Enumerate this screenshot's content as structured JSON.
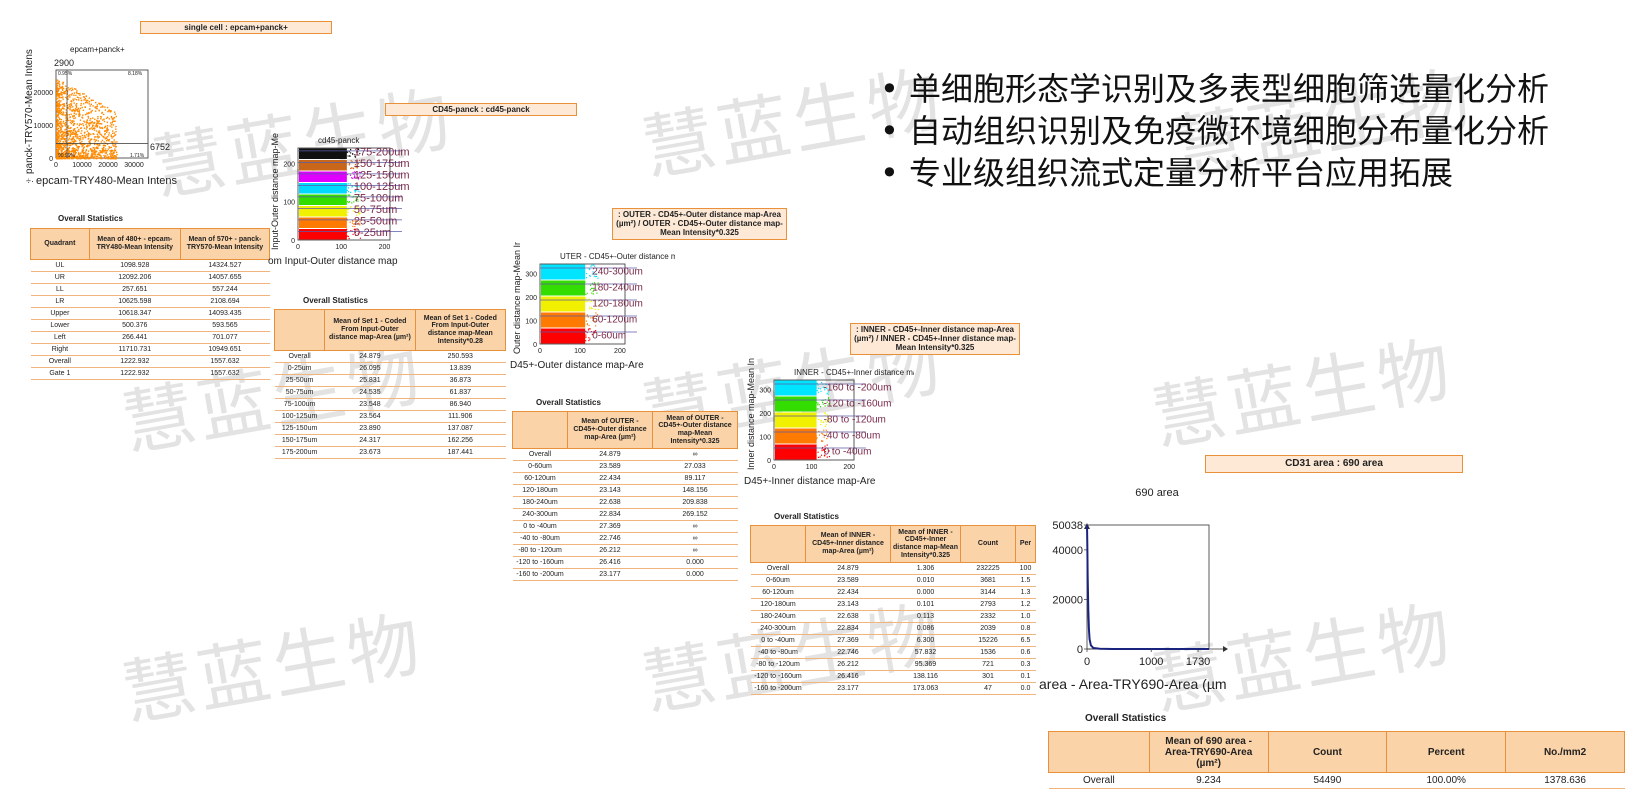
{
  "watermark": "慧蓝生物",
  "bullets": [
    "单细胞形态学识别及多表型细胞筛选量化分析",
    "自动组织识别及免疫微环境细胞分布量化分析",
    "专业级组织流式定量分析平台应用拓展"
  ],
  "panel1": {
    "title": "single cell : epcam+panck+",
    "stats_title": "Overall Statistics",
    "headers": [
      "Quadrant",
      "Mean of 480+ - epcam-TRY480-Mean Intensity",
      "Mean of 570+ - panck-TRY570-Mean Intensity"
    ],
    "rows": [
      [
        "UL",
        "1098.928",
        "14324.527"
      ],
      [
        "UR",
        "12092.206",
        "14057.655"
      ],
      [
        "LL",
        "257.651",
        "557.244"
      ],
      [
        "LR",
        "10625.598",
        "2108.694"
      ],
      [
        "Upper",
        "10618.347",
        "14093.435"
      ],
      [
        "Lower",
        "500.376",
        "593.565"
      ],
      [
        "Left",
        "266.441",
        "701.077"
      ],
      [
        "Right",
        "11710.731",
        "10949.651"
      ],
      [
        "Overall",
        "1222.932",
        "1557.632"
      ],
      [
        "Gate 1",
        "1222.932",
        "1557.632"
      ]
    ]
  },
  "panel2": {
    "title": "CD45-panck : cd45-panck",
    "stats_title": "Overall Statistics",
    "headers": [
      "",
      "Mean of Set 1 - Coded From Input-Outer distance map-Area (µm²)",
      "Mean of Set 1 - Coded From Input-Outer distance map-Mean Intensity*0.28"
    ],
    "rows": [
      [
        "Overall",
        "24.879",
        "250.593"
      ],
      [
        "0-25um",
        "26.095",
        "13.839"
      ],
      [
        "25-50um",
        "25.831",
        "36.873"
      ],
      [
        "50-75um",
        "24.535",
        "61.837"
      ],
      [
        "75-100um",
        "23.548",
        "86.940"
      ],
      [
        "100-125um",
        "23.564",
        "111.906"
      ],
      [
        "125-150um",
        "23.890",
        "137.087"
      ],
      [
        "150-175um",
        "24.317",
        "162.256"
      ],
      [
        "175-200um",
        "23.673",
        "187.441"
      ]
    ]
  },
  "panel3": {
    "title": ": OUTER - CD45+-Outer distance map-Area (µm²) / OUTER - CD45+-Outer distance map-Mean Intensity*0.325",
    "stats_title": "Overall Statistics",
    "headers": [
      "",
      "Mean of OUTER - CD45+-Outer distance map-Area (µm²)",
      "Mean of OUTER - CD45+-Outer distance map-Mean Intensity*0.325"
    ],
    "rows": [
      [
        "Overall",
        "24.879",
        "∞"
      ],
      [
        "0-60um",
        "23.589",
        "27.033"
      ],
      [
        "60-120um",
        "22.434",
        "89.117"
      ],
      [
        "120-180um",
        "23.143",
        "148.156"
      ],
      [
        "180-240um",
        "22.638",
        "209.838"
      ],
      [
        "240-300um",
        "22.834",
        "269.152"
      ],
      [
        "0 to -40um",
        "27.369",
        "∞"
      ],
      [
        "-40 to -80um",
        "22.746",
        "∞"
      ],
      [
        "-80 to -120um",
        "26.212",
        "∞"
      ],
      [
        "-120 to -160um",
        "26.416",
        "0.000"
      ],
      [
        "-160 to -200um",
        "23.177",
        "0.000"
      ]
    ]
  },
  "panel4": {
    "title": ": INNER - CD45+-Inner distance map-Area (µm²) / INNER - CD45+-Inner distance map-Mean Intensity*0.325",
    "stats_title": "Overall Statistics",
    "headers": [
      "",
      "Mean of INNER - CD45+-Inner distance map-Area (µm²)",
      "Mean of INNER - CD45+-Inner distance map-Mean Intensity*0.325",
      "Count",
      "Per"
    ],
    "rows": [
      [
        "Overall",
        "24.879",
        "1.306",
        "232225",
        "100"
      ],
      [
        "0-60um",
        "23.589",
        "0.010",
        "3681",
        "1.5"
      ],
      [
        "60-120um",
        "22.434",
        "0.000",
        "3144",
        "1.3"
      ],
      [
        "120-180um",
        "23.143",
        "0.101",
        "2793",
        "1.2"
      ],
      [
        "180-240um",
        "22.638",
        "0.113",
        "2332",
        "1.0"
      ],
      [
        "240-300um",
        "22.834",
        "0.086",
        "2039",
        "0.8"
      ],
      [
        "0 to -40um",
        "27.369",
        "6.300",
        "15226",
        "6.5"
      ],
      [
        "-40 to -80um",
        "22.746",
        "57.832",
        "1536",
        "0.6"
      ],
      [
        "-80 to -120um",
        "26.212",
        "95.369",
        "721",
        "0.3"
      ],
      [
        "-120 to -160um",
        "26.416",
        "138.116",
        "301",
        "0.1"
      ],
      [
        "-160 to -200um",
        "23.177",
        "173.063",
        "47",
        "0.0"
      ]
    ]
  },
  "panel5": {
    "title": "CD31 area : 690 area",
    "stats_title": "Overall Statistics",
    "headers": [
      "",
      "Mean of 690 area - Area-TRY690-Area (µm²)",
      "Count",
      "Percent",
      "No./mm2"
    ],
    "rows": [
      [
        "Overall",
        "9.234",
        "54490",
        "100.00%",
        "1378.636"
      ]
    ]
  },
  "chart_data": [
    {
      "type": "scatter",
      "title": "epcam+panck+",
      "xlabel": "epcam-TRY480-Mean Intens",
      "ylabel": "panck-TRY570-Mean Intens",
      "xlim": [
        0,
        35000
      ],
      "ylim": [
        0,
        17000
      ],
      "x_ticks": [
        "0",
        "10000",
        "20000",
        "30000"
      ],
      "y_ticks": [
        "0",
        "10000",
        "20000"
      ],
      "gate_labels": [
        "2900",
        "6752"
      ],
      "quadrant_percents": {
        "UL": "0.95%",
        "UR": "8.18%",
        "LL": "90.99%",
        "LR": "1.71%"
      },
      "color": "#ff8a00"
    },
    {
      "type": "scatter",
      "title": "cd45-panck",
      "xlabel": "om Input-Outer distance map",
      "ylabel": "Input-Outer distance map-Me",
      "xlim": [
        0,
        210
      ],
      "ylim": [
        0,
        210
      ],
      "x_ticks": [
        "0",
        "100",
        "200"
      ],
      "y_ticks": [
        "0",
        "100",
        "200"
      ],
      "bands": [
        {
          "label": "175-200um",
          "color": "#111111"
        },
        {
          "label": "150-175um",
          "color": "#c8661a"
        },
        {
          "label": "125-150um",
          "color": "#e000ff"
        },
        {
          "label": "100-125um",
          "color": "#00d8ff"
        },
        {
          "label": "75-100um",
          "color": "#33dd00"
        },
        {
          "label": "50-75um",
          "color": "#f0f000"
        },
        {
          "label": "25-50um",
          "color": "#ff7a00"
        },
        {
          "label": "0-25um",
          "color": "#ff0000"
        }
      ]
    },
    {
      "type": "scatter",
      "title": "UTER - CD45+-Outer distance ma...",
      "xlabel": "D45+-Outer distance map-Are",
      "ylabel": "Outer distance map-Mean Int",
      "xlim": [
        0,
        210
      ],
      "ylim": [
        0,
        310
      ],
      "x_ticks": [
        "0",
        "100",
        "200"
      ],
      "y_ticks": [
        "0",
        "100",
        "200",
        "300"
      ],
      "bands": [
        {
          "label": "240-300um",
          "color": "#00e5ff"
        },
        {
          "label": "180-240um",
          "color": "#33dd00"
        },
        {
          "label": "120-180um",
          "color": "#f0f000"
        },
        {
          "label": "60-120um",
          "color": "#ff7a00"
        },
        {
          "label": "0-60um",
          "color": "#ff0000"
        }
      ]
    },
    {
      "type": "scatter",
      "title": "INNER - CD45+-Inner distance ma...",
      "xlabel": "D45+-Inner distance map-Are",
      "ylabel": "Inner distance map-Mean Int",
      "xlim": [
        0,
        210
      ],
      "ylim": [
        0,
        310
      ],
      "x_ticks": [
        "0",
        "100",
        "200"
      ],
      "y_ticks": [
        "0",
        "100",
        "200",
        "300"
      ],
      "bands": [
        {
          "label": "-160 to -200um",
          "color": "#00e5ff"
        },
        {
          "label": "-120 to -160um",
          "color": "#33dd00"
        },
        {
          "label": "-80 to -120um",
          "color": "#f0f000"
        },
        {
          "label": "-40 to -80um",
          "color": "#ff7a00"
        },
        {
          "label": "0 to -40um",
          "color": "#ff0000"
        }
      ]
    },
    {
      "type": "line",
      "title": "690 area",
      "xlabel": "area - Area-TRY690-Area (µm",
      "xlim": [
        0,
        1900
      ],
      "ylim": [
        0,
        50038
      ],
      "x_ticks": [
        "0",
        "1000",
        "1730"
      ],
      "y_ticks": [
        "0",
        "20000",
        "40000",
        "50038"
      ],
      "x": [
        0,
        5,
        10,
        20,
        30,
        40,
        60,
        100,
        200,
        400,
        1900
      ],
      "y": [
        50038,
        42000,
        30000,
        16000,
        8000,
        4000,
        1500,
        400,
        80,
        10,
        0
      ],
      "color": "#1a237e"
    }
  ]
}
